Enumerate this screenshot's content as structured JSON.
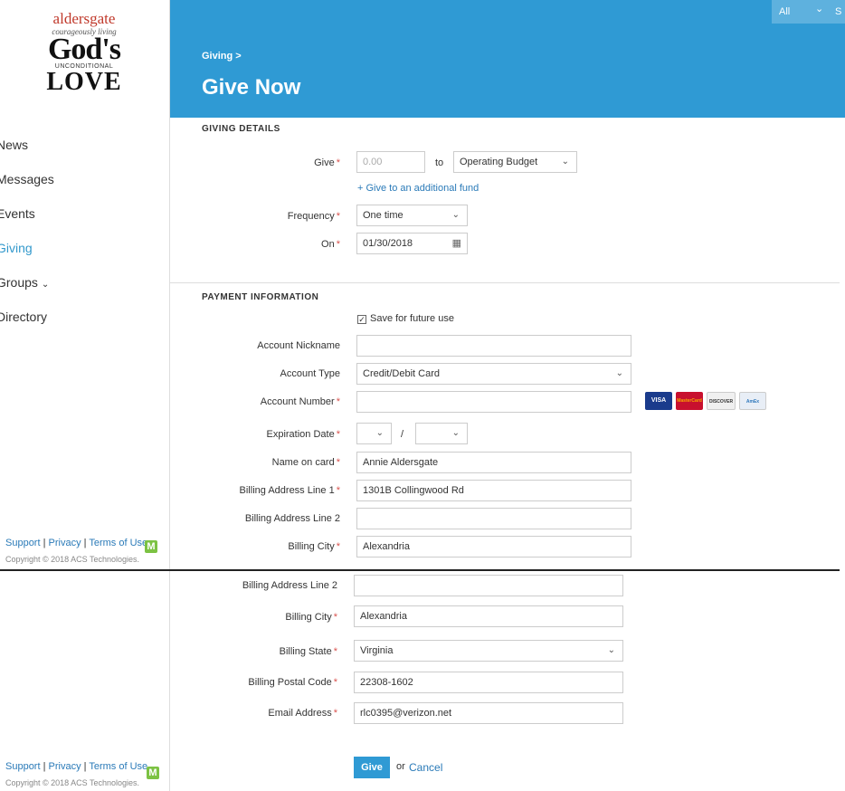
{
  "logo": {
    "line1": "aldersgate",
    "line2": "courageously living",
    "line3": "God's",
    "line4": "UNCONDITIONAL",
    "line5": "LOVE"
  },
  "nav": {
    "items": [
      "News",
      "Messages",
      "Events",
      "Giving",
      "Groups",
      "Directory"
    ],
    "active": "Giving",
    "groups_chevron": "chevron-down-icon"
  },
  "footer": {
    "support": "Support",
    "privacy": "Privacy",
    "terms": "Terms of Use",
    "separator": "|",
    "copyright": "Copyright © 2018 ACS Technologies.",
    "badge": "M"
  },
  "header": {
    "breadcrumb": "Giving >",
    "title": "Give Now",
    "search_scope": "All",
    "search_scope_chevron": "⌄",
    "search_partial": "S"
  },
  "giving": {
    "section": "GIVING DETAILS",
    "give_label": "Give",
    "amount_placeholder": "0.00",
    "to_text": "to",
    "fund": "Operating Budget",
    "additional_fund_link": "+ Give to an additional fund",
    "frequency_label": "Frequency",
    "frequency": "One time",
    "on_label": "On",
    "date": "01/30/2018"
  },
  "payment": {
    "section": "PAYMENT INFORMATION",
    "save_future": "Save for future use",
    "save_checked": true,
    "nickname_label": "Account Nickname",
    "nickname": "",
    "account_type_label": "Account Type",
    "account_type": "Credit/Debit Card",
    "account_number_label": "Account Number",
    "account_number": "",
    "cards": [
      "VISA",
      "MasterCard",
      "DISCOVER",
      "AmEx"
    ],
    "expiration_label": "Expiration Date",
    "exp_separator": "/",
    "name_label": "Name on card",
    "name": "Annie Aldersgate",
    "billing1_label": "Billing Address Line 1",
    "billing1": "1301B Collingwood Rd",
    "billing2_label": "Billing Address Line 2",
    "billing2": "",
    "city_label": "Billing City",
    "city": "Alexandria",
    "state_label": "Billing State",
    "state": "Virginia",
    "postal_label": "Billing Postal Code",
    "postal": "22308-1602",
    "email_label": "Email Address",
    "email": "rlc0395@verizon.net"
  },
  "actions": {
    "give_button": "Give",
    "or_text": "or",
    "cancel_link": "Cancel"
  },
  "colors": {
    "header_blue": "#2f9ad4",
    "link_blue": "#2a7ab8",
    "required_red": "#d9534f"
  }
}
